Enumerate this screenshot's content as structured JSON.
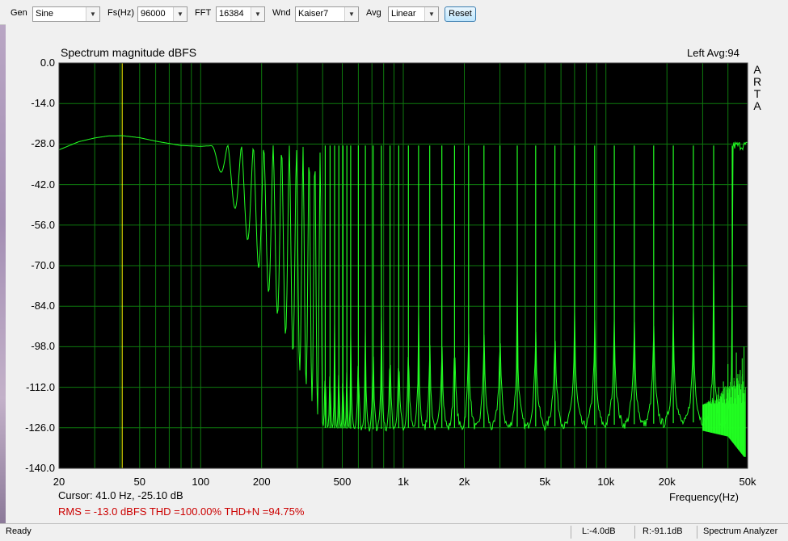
{
  "toolbar": {
    "gen_label": "Gen",
    "gen_value": "Sine",
    "fs_label": "Fs(Hz)",
    "fs_value": "96000",
    "fft_label": "FFT",
    "fft_value": "16384",
    "wnd_label": "Wnd",
    "wnd_value": "Kaiser7",
    "avg_label": "Avg",
    "avg_value": "Linear",
    "reset_label": "Reset"
  },
  "plot": {
    "title": "Spectrum magnitude dBFS",
    "channel_avg": "Left  Avg:94",
    "side_label": [
      "A",
      "R",
      "T",
      "A"
    ],
    "x_title": "Frequency(Hz)",
    "cursor_text": "Cursor:    41.0 Hz, -25.10 dB",
    "stats_text": "RMS =  -13.0 dBFS   THD =100.00%   THD+N =94.75%",
    "colors": {
      "background": "#000000",
      "grid": "#0e7a0e",
      "trace": "#22ff22",
      "cursor": "#ffff00"
    }
  },
  "chart_data": {
    "type": "line",
    "title": "Spectrum magnitude dBFS",
    "xlabel": "Frequency(Hz)",
    "ylabel": "",
    "x_scale": "log",
    "xlim": [
      20,
      50000
    ],
    "ylim": [
      -140,
      0
    ],
    "grid": true,
    "yticks": [
      "0.0",
      "-14.0",
      "-28.0",
      "-42.0",
      "-56.0",
      "-70.0",
      "-84.0",
      "-98.0",
      "-112.0",
      "-126.0",
      "-140.0"
    ],
    "xticks": [
      {
        "f": 20,
        "label": "20"
      },
      {
        "f": 50,
        "label": "50"
      },
      {
        "f": 100,
        "label": "100"
      },
      {
        "f": 200,
        "label": "200"
      },
      {
        "f": 500,
        "label": "500"
      },
      {
        "f": 1000,
        "label": "1k"
      },
      {
        "f": 2000,
        "label": "2k"
      },
      {
        "f": 5000,
        "label": "5k"
      },
      {
        "f": 10000,
        "label": "10k"
      },
      {
        "f": 20000,
        "label": "20k"
      },
      {
        "f": 50000,
        "label": "50k"
      }
    ],
    "cursor": {
      "freq_hz": 41.0,
      "level_db": -25.1
    },
    "envelope": [
      [
        20,
        -30.0
      ],
      [
        25,
        -27.2
      ],
      [
        30,
        -25.9
      ],
      [
        35,
        -25.2
      ],
      [
        41,
        -25.1
      ],
      [
        50,
        -25.8
      ],
      [
        60,
        -27.0
      ],
      [
        70,
        -27.8
      ],
      [
        80,
        -28.5
      ],
      [
        100,
        -28.8
      ],
      [
        130,
        -28.3
      ],
      [
        160,
        -28.6
      ],
      [
        200,
        -28.5
      ],
      [
        500,
        -28.5
      ],
      [
        50000,
        -28.5
      ]
    ],
    "harmonics_hz": [
      113,
      136,
      159,
      182,
      205,
      228,
      251,
      274,
      297,
      320,
      343,
      366,
      389,
      412,
      435,
      458,
      481,
      504,
      527,
      550,
      600,
      650,
      710,
      780,
      860,
      950,
      1060,
      1190,
      1350,
      1550,
      1790,
      2100,
      2500,
      3000,
      3650,
      4500,
      5600,
      7000,
      8800,
      11000,
      13800,
      17200,
      21500,
      27000,
      34000,
      42000
    ],
    "noise_floor": [
      [
        400,
        -126
      ],
      [
        700,
        -126.5
      ],
      [
        1000,
        -126
      ],
      [
        2000,
        -126
      ],
      [
        5000,
        -125.5
      ],
      [
        10000,
        -125
      ],
      [
        20000,
        -124.5
      ],
      [
        30000,
        -124
      ],
      [
        40000,
        -126
      ],
      [
        48000,
        -133
      ]
    ],
    "hf_noise_spikes": [
      [
        36000,
        -112
      ],
      [
        38000,
        -110
      ],
      [
        40000,
        -104
      ],
      [
        42000,
        -102
      ],
      [
        44000,
        -100
      ],
      [
        46000,
        -106
      ],
      [
        47000,
        -102
      ],
      [
        48000,
        -98
      ]
    ]
  },
  "status": {
    "ready": "Ready",
    "left_level": "L:-4.0dB",
    "right_level": "R:-91.1dB",
    "mode": "Spectrum Analyzer"
  }
}
